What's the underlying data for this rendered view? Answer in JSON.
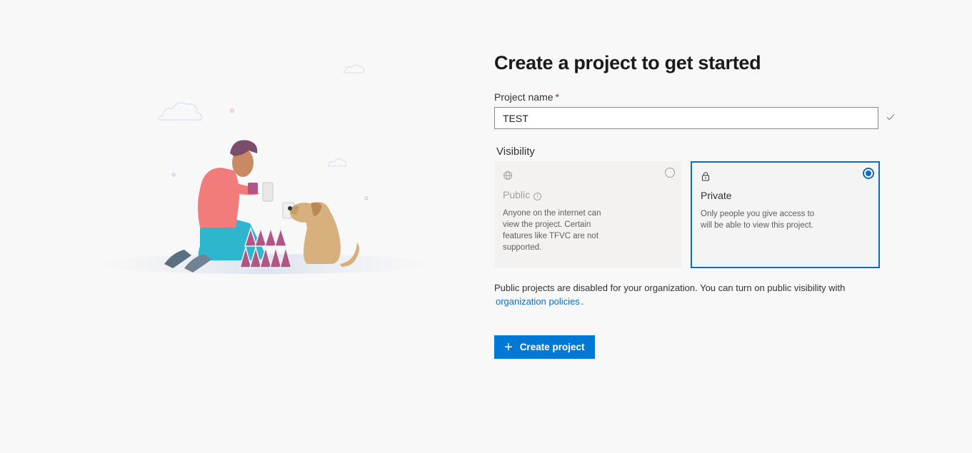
{
  "page": {
    "title": "Create a project to get started"
  },
  "project_name": {
    "label": "Project name",
    "required_mark": "*",
    "value": "TEST"
  },
  "visibility": {
    "label": "Visibility",
    "options": [
      {
        "key": "public",
        "icon": "globe-icon",
        "title": "Public",
        "description": "Anyone on the internet can view the project. Certain features like TFVC are not supported.",
        "selected": false,
        "disabled": true
      },
      {
        "key": "private",
        "icon": "lock-icon",
        "title": "Private",
        "description": "Only people you give access to will be able to view this project.",
        "selected": true,
        "disabled": false
      }
    ]
  },
  "notice": {
    "text": "Public projects are disabled for your organization. You can turn on public visibility with",
    "link": "organization policies",
    "suffix": "."
  },
  "actions": {
    "create_icon": "plus-icon",
    "create_label": "Create project"
  },
  "colors": {
    "accent": "#0078d4",
    "selected_border": "#0f6cbd",
    "background": "#f8f8f8"
  }
}
